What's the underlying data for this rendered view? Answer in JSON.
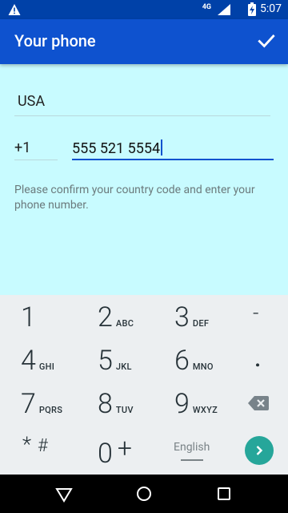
{
  "status_bar": {
    "network": "4G",
    "time": "5:07",
    "icons": [
      "warning-icon",
      "signal-icon",
      "battery-icon"
    ]
  },
  "app_bar": {
    "title": "Your phone",
    "confirm_icon": "check-icon"
  },
  "form": {
    "country": "USA",
    "country_code": "+1",
    "phone_number": "555 521 5554",
    "hint": "Please confirm your country code and enter your phone number."
  },
  "keypad": {
    "keys": [
      {
        "num": "1",
        "letters": ""
      },
      {
        "num": "2",
        "letters": "ABC"
      },
      {
        "num": "3",
        "letters": "DEF"
      },
      {
        "num": "-",
        "letters": ""
      },
      {
        "num": "4",
        "letters": "GHI"
      },
      {
        "num": "5",
        "letters": "JKL"
      },
      {
        "num": "6",
        "letters": "MNO"
      },
      {
        "num": ".",
        "letters": ""
      },
      {
        "num": "7",
        "letters": "PQRS"
      },
      {
        "num": "8",
        "letters": "TUV"
      },
      {
        "num": "9",
        "letters": "WXYZ"
      },
      {
        "num": "*",
        "letters": "#"
      },
      {
        "num": "0",
        "letters": "+"
      }
    ],
    "language": "English",
    "backspace_icon": "backspace-icon",
    "go_icon": "chevron-right-icon",
    "accent": "#26a69a"
  },
  "colors": {
    "status_bar": "#0041a8",
    "app_bar": "#0e52cf",
    "content_bg": "#c8fbff",
    "keypad_bg": "#eceff1"
  },
  "nav_bar": {
    "icons": [
      "back-icon",
      "home-icon",
      "recents-icon"
    ]
  }
}
